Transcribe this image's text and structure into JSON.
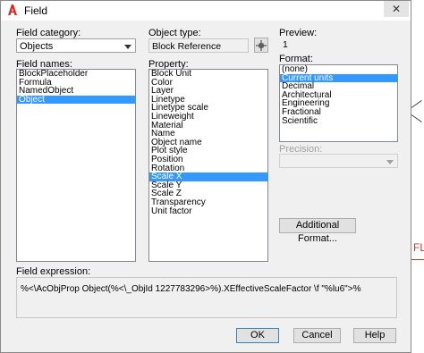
{
  "window": {
    "title": "Field",
    "close_glyph": "✕"
  },
  "field_category": {
    "label": "Field category:",
    "value": "Objects"
  },
  "field_names": {
    "label": "Field names:",
    "items": [
      "BlockPlaceholder",
      "Formula",
      "NamedObject",
      "Object"
    ],
    "selected": "Object"
  },
  "object_type": {
    "label": "Object type:",
    "value": "Block Reference"
  },
  "property": {
    "label": "Property:",
    "items": [
      "Block Unit",
      "Color",
      "Layer",
      "Linetype",
      "Linetype scale",
      "Lineweight",
      "Material",
      "Name",
      "Object name",
      "Plot style",
      "Position",
      "Rotation",
      "Scale X",
      "Scale Y",
      "Scale Z",
      "Transparency",
      "Unit factor"
    ],
    "selected": "Scale X"
  },
  "preview": {
    "label": "Preview:",
    "value": "1"
  },
  "format": {
    "label": "Format:",
    "items": [
      "(none)",
      "Current units",
      "Decimal",
      "Architectural",
      "Engineering",
      "Fractional",
      "Scientific"
    ],
    "selected": "Current units"
  },
  "precision": {
    "label": "Precision:",
    "value": ""
  },
  "buttons": {
    "additional_format": "Additional Format...",
    "ok": "OK",
    "cancel": "Cancel",
    "help": "Help"
  },
  "field_expression": {
    "label": "Field expression:",
    "value": "%<\\AcObjProp Object(%<\\_ObjId 1227783296>%).XEffectiveScaleFactor \\f \"%lu6\">%"
  },
  "background": {
    "fragment_text": "FL"
  },
  "colors": {
    "selection": "#3399ff",
    "dialog_bg": "#f0f0f0",
    "app_icon_red": "#d9261c"
  }
}
